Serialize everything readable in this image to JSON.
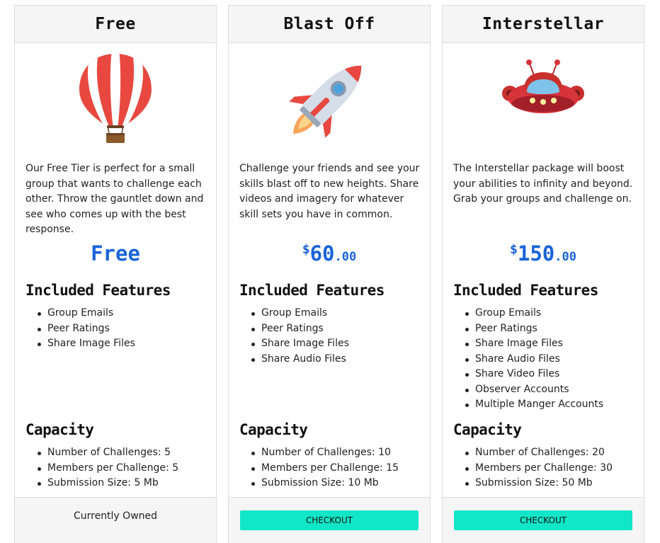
{
  "plans": [
    {
      "title": "Free",
      "illustration": "hot-air-balloon",
      "description": "Our Free Tier is perfect for a small group that wants to challenge each other. Throw the gauntlet down and see who comes up with the best response.",
      "price": {
        "currency": "",
        "amount": "Free",
        "cents": ""
      },
      "features_title": "Included Features",
      "features": [
        "Group Emails",
        "Peer Ratings",
        "Share Image Files"
      ],
      "capacity_title": "Capacity",
      "capacity": [
        "Number of Challenges: 5",
        "Members per Challenge: 5",
        "Submission Size: 5 Mb"
      ],
      "footer": {
        "type": "status",
        "label": "Currently Owned"
      }
    },
    {
      "title": "Blast Off",
      "illustration": "rocket",
      "description": "Challenge your friends and see your skills blast off to new heights. Share videos and imagery for whatever skill sets you have in common.",
      "price": {
        "currency": "$",
        "amount": "60",
        "cents": ".00"
      },
      "features_title": "Included Features",
      "features": [
        "Group Emails",
        "Peer Ratings",
        "Share Image Files",
        "Share Audio Files"
      ],
      "capacity_title": "Capacity",
      "capacity": [
        "Number of Challenges: 10",
        "Members per Challenge: 15",
        "Submission Size: 10 Mb"
      ],
      "footer": {
        "type": "button",
        "label": "CHECKOUT"
      }
    },
    {
      "title": "Interstellar",
      "illustration": "ufo",
      "description": "The Interstellar package will boost your abilities to infinity and beyond. Grab your groups and challenge on.",
      "price": {
        "currency": "$",
        "amount": "150",
        "cents": ".00"
      },
      "features_title": "Included Features",
      "features": [
        "Group Emails",
        "Peer Ratings",
        "Share Image Files",
        "Share Audio Files",
        "Share Video Files",
        "Observer Accounts",
        "Multiple Manger Accounts"
      ],
      "capacity_title": "Capacity",
      "capacity": [
        "Number of Challenges: 20",
        "Members per Challenge: 30",
        "Submission Size: 50 Mb"
      ],
      "footer": {
        "type": "button",
        "label": "CHECKOUT"
      }
    }
  ],
  "colors": {
    "price": "#1a64d8",
    "checkout": "#12e6c8",
    "header_bg": "#f5f5f5"
  }
}
